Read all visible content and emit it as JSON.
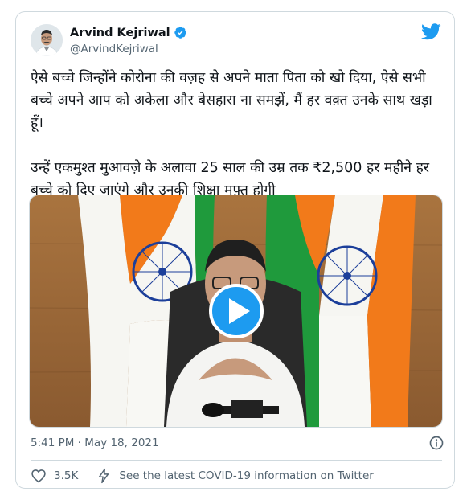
{
  "author": {
    "name": "Arvind Kejriwal",
    "handle": "@ArvindKejriwal"
  },
  "tweet": {
    "text": "ऐसे बच्चे जिन्होंने कोरोना की वज़ह से अपने माता पिता को खो दिया, ऐसे सभी बच्चे अपने आप को अकेला और बेसहारा ना समझें, मैं हर वक़्त उनके साथ खड़ा हूँ।\n\nउन्हें एकमुश्त मुआवज़े के अलावा 25 साल की उम्र तक ₹2,500 हर महीने हर बच्चे को दिए जाएंगे और उनकी शिक्षा मुफ़्त होगी",
    "timestamp": "5:41 PM · May 18, 2021"
  },
  "actions": {
    "like_count": "3.5K",
    "covid_info": "See the latest COVID-19 information on Twitter"
  },
  "colors": {
    "twitter_blue": "#1d9bf0",
    "text_secondary": "#536471",
    "border": "#cfd9de"
  },
  "icons": [
    "avatar",
    "verified-badge-icon",
    "twitter-bird-icon",
    "play-icon",
    "info-icon",
    "heart-icon",
    "lightning-icon"
  ]
}
